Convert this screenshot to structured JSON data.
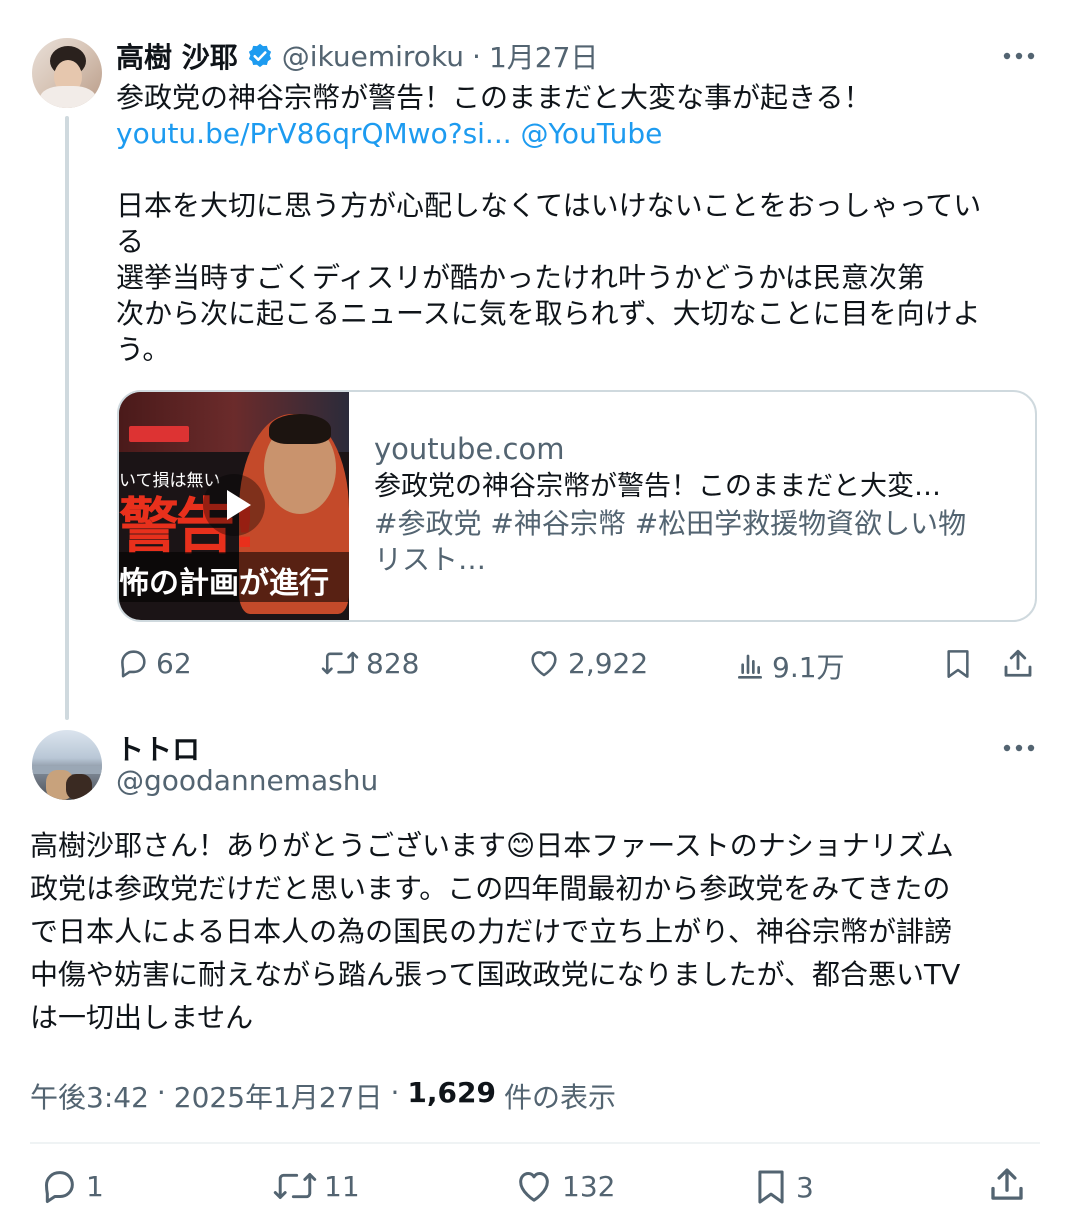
{
  "main_tweet": {
    "display_name": "高樹 沙耶",
    "handle": "@ikuemiroku",
    "separator": "·",
    "date": "1月27日",
    "text_line1": "参政党の神谷宗幣が警告！このままだと大変な事が起きる！",
    "link_url": "youtu.be/PrV86qrQMwo?si...",
    "link_mention": "@YouTube",
    "body_lines": [
      "日本を大切に思う方が心配しなくてはいけないことをおっしゃってい",
      "る",
      "選挙当時すごくディスリが酷かったけれ叶うかどうかは民意次第",
      "次から次に起こるニュースに気を取られず、大切なことに目を向けよ",
      "う。"
    ],
    "card": {
      "domain": "youtube.com",
      "title": "参政党の神谷宗幣が警告！このままだと大変…",
      "hashtags_line1": "#参政党 #神谷宗幣 #松田学救援物資欲しい物",
      "hashtags_line2": "リスト…",
      "thumb_text_top": "いて損は無い",
      "thumb_text_big": "警告!",
      "thumb_text_bottom": "怖の計画が進行"
    },
    "replies": "62",
    "retweets": "828",
    "likes": "2,922",
    "views": "9.1万"
  },
  "reply_tweet": {
    "display_name": "トトロ",
    "handle": "@goodannemashu",
    "body_lines": [
      "高樹沙耶さん！ありがとうございます😊日本ファーストのナショナリズム",
      "政党は参政党だけだと思います。この四年間最初から参政党をみてきたの",
      "で日本人による日本人の為の国民の力だけで立ち上がり、神谷宗幣が誹謗",
      "中傷や妨害に耐えながら踏ん張って国政政党になりましたが、都合悪いTV",
      "は一切出しません"
    ],
    "time": "午後3:42",
    "sep1": "·",
    "date": "2025年1月27日",
    "sep2": "·",
    "views_count": "1,629",
    "views_label": "件の表示",
    "replies": "1",
    "retweets": "11",
    "likes": "132",
    "bookmarks": "3"
  },
  "icons": [
    "verified-badge-icon",
    "more-icon",
    "reply-icon",
    "retweet-icon",
    "like-icon",
    "views-icon",
    "bookmark-icon",
    "share-icon",
    "play-icon"
  ],
  "colors": {
    "link": "#1d9bf0",
    "muted": "#536471",
    "text": "#0f1419",
    "divider": "#eff3f4",
    "verified": "#1d9bf0"
  }
}
